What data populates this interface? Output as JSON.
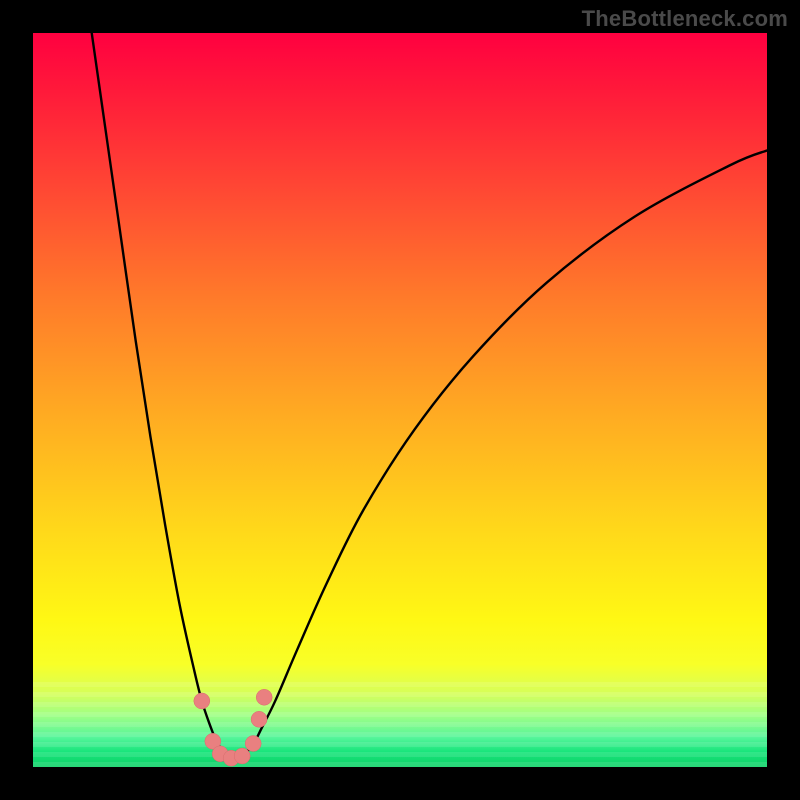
{
  "watermark": "TheBottleneck.com",
  "colors": {
    "frame": "#000000",
    "curve": "#000000",
    "dot_fill": "#e98080",
    "dot_stroke": "#d86c6c",
    "gradient_top": "#ff0040",
    "gradient_bottom": "#0fd268"
  },
  "chart_data": {
    "type": "line",
    "title": "",
    "xlabel": "",
    "ylabel": "",
    "xlim": [
      0,
      100
    ],
    "ylim": [
      0,
      100
    ],
    "grid": false,
    "legend": false,
    "series": [
      {
        "name": "left-branch",
        "x": [
          8,
          10,
          12,
          14,
          16,
          18,
          20,
          22,
          23,
          24,
          25,
          26
        ],
        "y": [
          100,
          86,
          72,
          58,
          45,
          33,
          22,
          13,
          9,
          6,
          3.5,
          2
        ]
      },
      {
        "name": "right-branch",
        "x": [
          29,
          30,
          31,
          33,
          36,
          40,
          45,
          52,
          60,
          70,
          82,
          95,
          100
        ],
        "y": [
          2,
          3,
          5,
          9,
          16,
          25,
          35,
          46,
          56,
          66,
          75,
          82,
          84
        ]
      }
    ],
    "markers": [
      {
        "x": 23.0,
        "y": 9.0
      },
      {
        "x": 24.5,
        "y": 3.5
      },
      {
        "x": 25.5,
        "y": 1.8
      },
      {
        "x": 27.0,
        "y": 1.2
      },
      {
        "x": 28.5,
        "y": 1.5
      },
      {
        "x": 30.0,
        "y": 3.2
      },
      {
        "x": 30.8,
        "y": 6.5
      },
      {
        "x": 31.5,
        "y": 9.5
      }
    ]
  }
}
